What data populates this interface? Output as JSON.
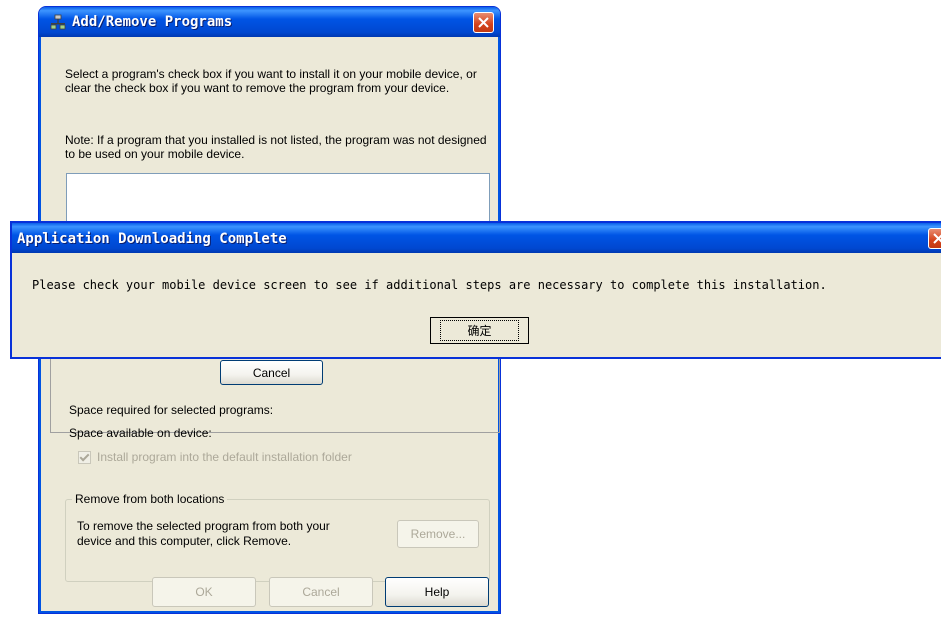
{
  "main_window": {
    "title": "Add/Remove Programs",
    "instructions": "Select a program's check box if you want to install it on your mobile device, or clear the check box if you want to remove the program from your device.",
    "note": "Note:  If a program that you installed is not listed, the program was not designed to be used on your mobile device.",
    "inner_cancel_label": "Cancel",
    "space_required_label": "Space required for selected programs:",
    "space_available_label": "Space available on device:",
    "install_default_folder_label": "Install program into the default installation folder",
    "install_default_folder_checked": true,
    "remove_group": {
      "legend": "Remove from both locations",
      "text": "To remove the selected program from both your device and this computer, click Remove.",
      "remove_label": "Remove..."
    },
    "footer": {
      "ok_label": "OK",
      "cancel_label": "Cancel",
      "help_label": "Help"
    }
  },
  "dialog": {
    "title": "Application Downloading Complete",
    "message": "Please check your mobile device screen to see if additional steps are necessary to complete this installation.",
    "ok_label": "确定"
  }
}
